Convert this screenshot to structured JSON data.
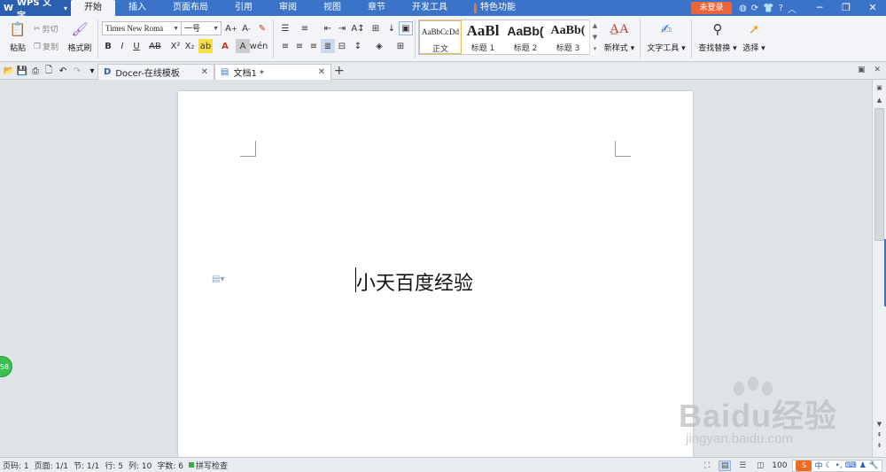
{
  "app": {
    "name": "WPS 文字",
    "logo": "W"
  },
  "menu": [
    {
      "label": "开始",
      "active": true
    },
    {
      "label": "插入"
    },
    {
      "label": "页面布局"
    },
    {
      "label": "引用"
    },
    {
      "label": "审阅"
    },
    {
      "label": "视图"
    },
    {
      "label": "章节"
    },
    {
      "label": "开发工具"
    },
    {
      "label": "特色功能"
    }
  ],
  "login_label": "未登录",
  "title_help": "?",
  "ribbon": {
    "paste": "粘贴",
    "cut": "剪切",
    "copy": "复制",
    "format_painter": "格式刷",
    "font_name": "Times New Roma",
    "font_size": "一号",
    "styles": [
      {
        "preview": "AaBbCcDd",
        "name": "正文",
        "active": true
      },
      {
        "preview": "AaBl",
        "name": "标题 1"
      },
      {
        "preview": "AaBb(",
        "name": "标题 2"
      },
      {
        "preview": "AaBb(",
        "name": "标题 3"
      }
    ],
    "new_style": "新样式",
    "text_tools": "文字工具",
    "find_replace": "查找替换",
    "select": "选择"
  },
  "tabs": [
    {
      "label": "Docer-在线模板"
    },
    {
      "label": "文档1 *",
      "active": true
    }
  ],
  "document": {
    "text": "小天百度经验"
  },
  "float_badge": "58",
  "status": {
    "page": "页码: 1",
    "pages": "页面: 1/1",
    "section": "节: 1/1",
    "row": "行: 5",
    "col": "列: 10",
    "words": "字数: 6",
    "spell": "拼写检查",
    "zoom": "100",
    "ime": "中"
  },
  "watermark": {
    "main": "Baidu经验",
    "sub": "jingyan.baidu.com"
  },
  "colors": {
    "titlebar": "#3a73c7",
    "login": "#e8663a",
    "accent": "#f0742a"
  }
}
